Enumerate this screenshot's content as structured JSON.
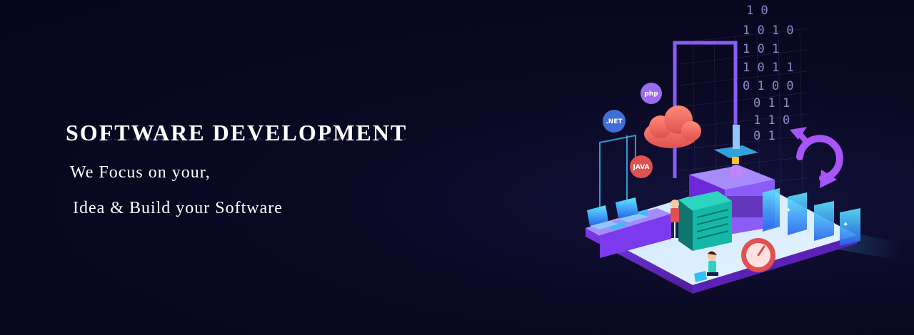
{
  "banner": {
    "headline": "SOFTWARE DEVELOPMENT",
    "tagline_line1": "We Focus on your,",
    "tagline_line2": "Idea & Build your Software"
  },
  "illustration": {
    "binary_rows": [
      "1 0",
      "1 0 1 0",
      "1 0 1",
      "1 0 1 1",
      "0 1 0 0",
      "0 1 1",
      "1 1 0",
      "0 1"
    ],
    "badges": [
      {
        "label": "php",
        "color": "#9b6cf0"
      },
      {
        "label": ".NET",
        "color": "#3f6fd6"
      },
      {
        "label": "JAVA",
        "color": "#e0514f"
      }
    ],
    "icons": [
      "cloud-icon",
      "laptop-icon",
      "gauge-icon",
      "refresh-arrow-icon"
    ]
  },
  "colors": {
    "background": "#07061a",
    "text": "#ffffff",
    "accent_purple": "#8b5cf6",
    "accent_blue": "#38bdf8",
    "accent_red": "#f05a5a"
  }
}
